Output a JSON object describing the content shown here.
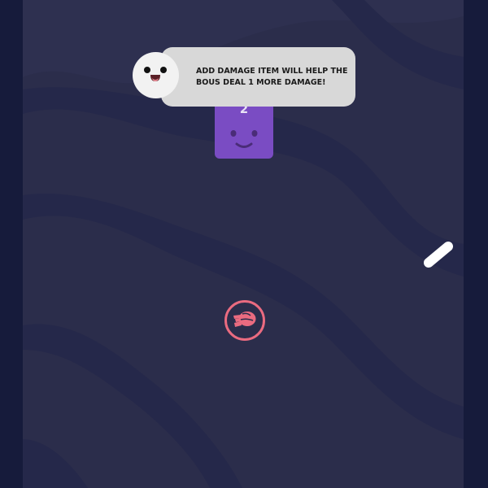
{
  "tutorial": {
    "message": "ADD DAMAGE ITEM WILL HELP THE BOUS DEAL 1 MORE DAMAGE!",
    "mascot_icon": "smiling-face-icon"
  },
  "enemy": {
    "hp": "2",
    "color": "#7a4cc3"
  },
  "player": {
    "launcher_icon": "fist-icon",
    "launcher_color": "#ea6b80",
    "paddle_color": "#ffffff"
  },
  "colors": {
    "background": "#2b2d4b",
    "border": "#161b3b",
    "tooltip": "#d8d8d8"
  }
}
